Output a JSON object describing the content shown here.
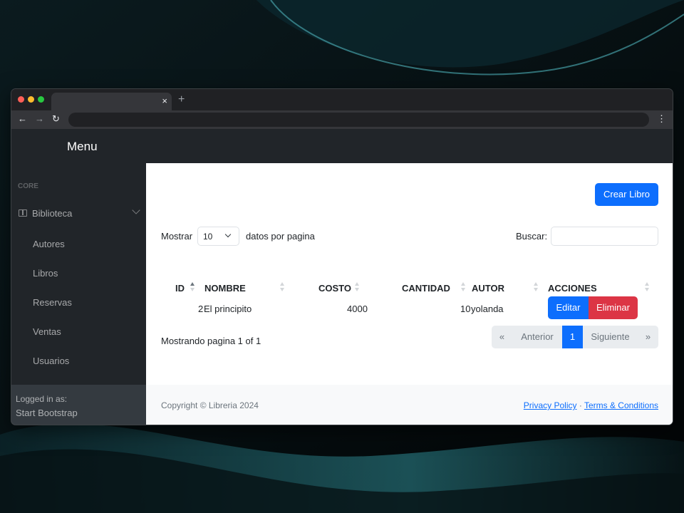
{
  "browser": {
    "tab_close": "×",
    "new_tab": "+",
    "back": "←",
    "forward": "→",
    "reload": "↻",
    "menu": "⋮"
  },
  "nav": {
    "brand": "Menu"
  },
  "sidebar": {
    "heading": "CORE",
    "parent": {
      "label": "Biblioteca",
      "icon": "book-icon",
      "expanded": true
    },
    "items": [
      {
        "label": "Autores"
      },
      {
        "label": "Libros"
      },
      {
        "label": "Reservas"
      },
      {
        "label": "Ventas"
      },
      {
        "label": "Usuarios"
      }
    ],
    "footer": {
      "label": "Logged in as:",
      "user": "Start Bootstrap"
    }
  },
  "main": {
    "create_button": "Crear Libro",
    "length": {
      "label": "Mostrar",
      "value": "10",
      "suffix": "datos por pagina"
    },
    "search": {
      "label": "Buscar:",
      "value": "",
      "placeholder": ""
    },
    "table": {
      "columns": [
        "ID",
        "NOMBRE",
        "COSTO",
        "CANTIDAD",
        "AUTOR",
        "ACCIONES"
      ],
      "sorted_column": "ID",
      "rows": [
        {
          "id": "2",
          "nombre": "El principito",
          "costo": "4000",
          "cantidad": "10",
          "autor": "yolanda"
        }
      ],
      "actions": {
        "edit": "Editar",
        "delete": "Eliminar"
      }
    },
    "info": "Mostrando pagina 1 of 1",
    "pagination": {
      "first": "«",
      "prev": "Anterior",
      "current": "1",
      "next": "Siguiente",
      "last": "»"
    }
  },
  "footer": {
    "copyright": "Copyright © Libreria 2024",
    "privacy": "Privacy Policy",
    "separator": "·",
    "terms": "Terms & Conditions"
  },
  "colors": {
    "primary": "#0d6efd",
    "danger": "#dc3545",
    "sidebar_bg": "#212529",
    "sidebar_footer_bg": "#343a40",
    "footer_bg": "#f8f9fa"
  }
}
